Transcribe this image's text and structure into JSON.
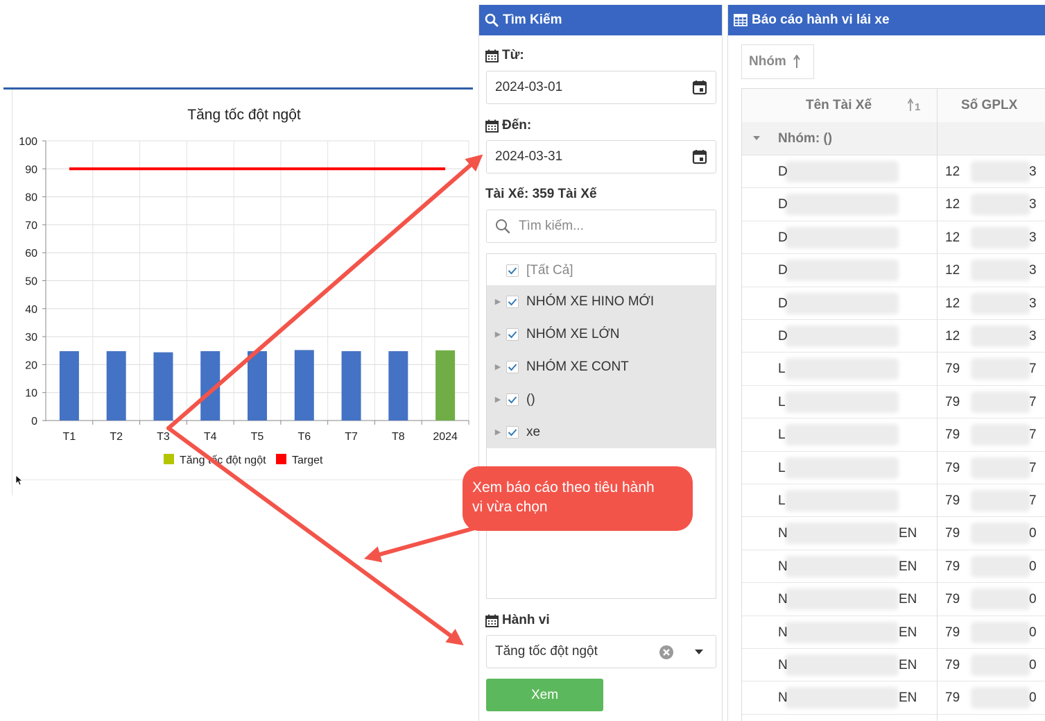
{
  "chart_data": {
    "type": "bar",
    "title": "Tăng tốc đột ngột",
    "categories": [
      "T1",
      "T2",
      "T3",
      "T4",
      "T5",
      "T6",
      "T7",
      "T8",
      "2024"
    ],
    "series": [
      {
        "name": "Tăng tốc đột ngột",
        "values": [
          24.8,
          24.8,
          24.4,
          24.8,
          24.8,
          25.2,
          24.8,
          24.8,
          25.1
        ],
        "color": "#4472c4",
        "last_color": "#70ad47"
      },
      {
        "name": "Target",
        "type": "line",
        "values": [
          90,
          90,
          90,
          90,
          90,
          90,
          90,
          90,
          90
        ],
        "color": "#ff0000"
      }
    ],
    "ylim": [
      0,
      100
    ],
    "yticks": [
      0,
      10,
      20,
      30,
      40,
      50,
      60,
      70,
      80,
      90,
      100
    ],
    "grid": true,
    "legend": "bottom",
    "legend_colors": {
      "series": "#b5c500",
      "target": "#ff0000"
    }
  },
  "search_panel": {
    "title": "Tìm Kiếm",
    "from_label": "Từ:",
    "from_value": "2024-03-01",
    "to_label": "Đến:",
    "to_value": "2024-03-31",
    "driver_label": "Tài Xế: 359 Tài Xế",
    "search_placeholder": "Tìm kiếm...",
    "select_all": "[Tất Cả]",
    "groups": [
      "NHÓM XE HINO MỚI",
      "NHÓM XE LỚN",
      "NHÓM XE CONT",
      "()",
      "xe"
    ],
    "behavior_label": "Hành vi",
    "behavior_value": "Tăng tốc đột ngột",
    "view_button": "Xem"
  },
  "report_panel": {
    "title": "Báo cáo hành vi lái xe",
    "group_button": "Nhóm",
    "col_driver": "Tên Tài Xế",
    "col_license": "Số GPLX",
    "group_row": "Nhóm: ()",
    "rows": [
      {
        "name_start": "D",
        "name_end": "",
        "lic_start": "12",
        "lic_end": "3"
      },
      {
        "name_start": "D",
        "name_end": "",
        "lic_start": "12",
        "lic_end": "3"
      },
      {
        "name_start": "D",
        "name_end": "",
        "lic_start": "12",
        "lic_end": "3"
      },
      {
        "name_start": "D",
        "name_end": "",
        "lic_start": "12",
        "lic_end": "3"
      },
      {
        "name_start": "D",
        "name_end": "",
        "lic_start": "12",
        "lic_end": "3"
      },
      {
        "name_start": "D",
        "name_end": "",
        "lic_start": "12",
        "lic_end": "3"
      },
      {
        "name_start": "L",
        "name_end": "",
        "lic_start": "79",
        "lic_end": "7"
      },
      {
        "name_start": "L",
        "name_end": "",
        "lic_start": "79",
        "lic_end": "7"
      },
      {
        "name_start": "L",
        "name_end": "",
        "lic_start": "79",
        "lic_end": "7"
      },
      {
        "name_start": "L",
        "name_end": "",
        "lic_start": "79",
        "lic_end": "7"
      },
      {
        "name_start": "L",
        "name_end": "",
        "lic_start": "79",
        "lic_end": "7"
      },
      {
        "name_start": "N",
        "name_end": "EN",
        "lic_start": "79",
        "lic_end": "0"
      },
      {
        "name_start": "N",
        "name_end": "EN",
        "lic_start": "79",
        "lic_end": "0"
      },
      {
        "name_start": "N",
        "name_end": "EN",
        "lic_start": "79",
        "lic_end": "0"
      },
      {
        "name_start": "N",
        "name_end": "EN",
        "lic_start": "79",
        "lic_end": "0"
      },
      {
        "name_start": "N",
        "name_end": "EN",
        "lic_start": "79",
        "lic_end": "0"
      },
      {
        "name_start": "N",
        "name_end": "EN",
        "lic_start": "79",
        "lic_end": "0"
      }
    ]
  },
  "callout": {
    "line1": "Xem báo cáo theo tiêu hành",
    "line2": "vi vừa chọn"
  },
  "colors": {
    "panel_header": "#3866c2",
    "view_button": "#5cb85c",
    "callout": "#f3544a",
    "arrow": "#f3544a"
  }
}
